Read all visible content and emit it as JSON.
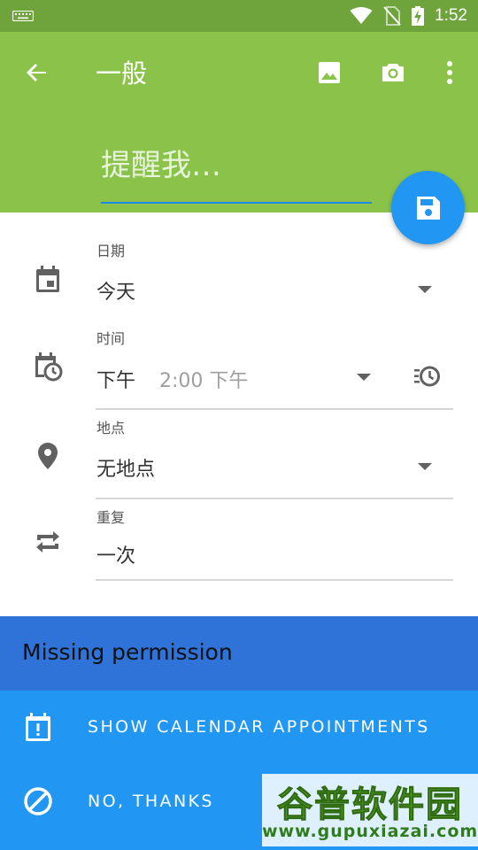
{
  "status_bar": {
    "time": "1:52",
    "icons": [
      "keyboard-icon",
      "wifi-icon",
      "no-sim-icon",
      "battery-charging-icon"
    ]
  },
  "app_bar": {
    "title": "一般",
    "actions": [
      "image-icon",
      "camera-icon",
      "more-vert-icon"
    ],
    "reminder_placeholder": "提醒我…",
    "colors": {
      "app_bar": "#8BC34A",
      "status_bar": "#6FA33C",
      "fab": "#2196F3"
    }
  },
  "form": {
    "date": {
      "label": "日期",
      "value": "今天"
    },
    "time": {
      "label": "时间",
      "period": "下午",
      "value": "2:00 下午"
    },
    "location": {
      "label": "地点",
      "value": "无地点"
    },
    "repeat": {
      "label": "重复",
      "value": "一次"
    }
  },
  "banner": {
    "title": "Missing permission",
    "actions": [
      {
        "label": "SHOW CALENDAR APPOINTMENTS",
        "icon": "calendar-alert-icon"
      },
      {
        "label": "NO, THANKS",
        "icon": "block-icon"
      }
    ],
    "colors": {
      "title_bg": "#3073D8",
      "actions_bg": "#2196F3"
    }
  },
  "watermark": {
    "name": "谷普软件园",
    "url": "www.gupuxiazai.com"
  }
}
